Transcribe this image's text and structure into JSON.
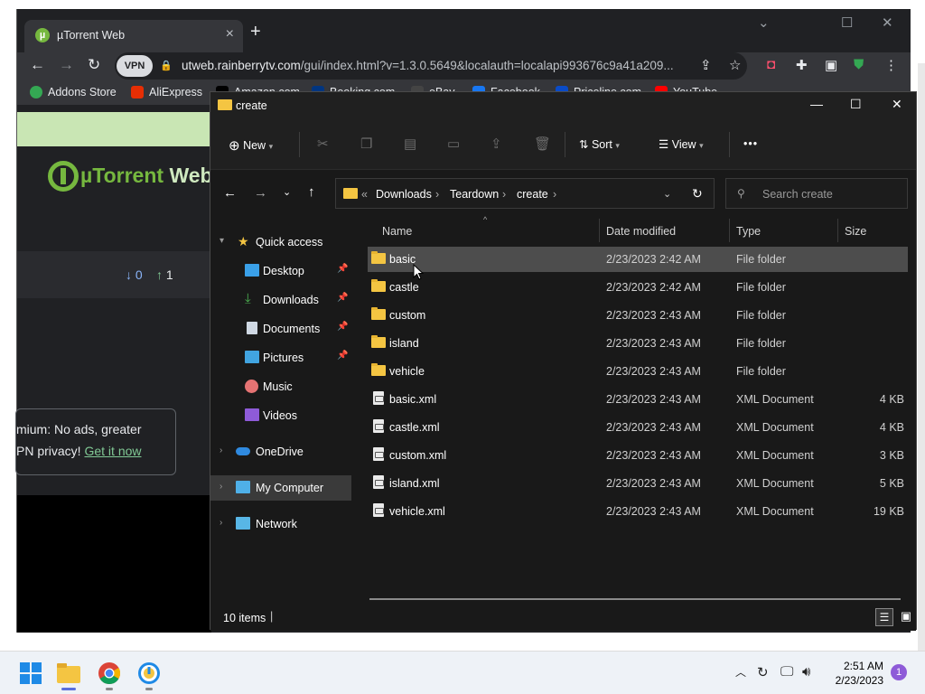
{
  "browser": {
    "tab_title": "µTorrent Web",
    "new_tab_icon": "plus-icon",
    "url_prefix": "utweb.rainberrytv.com",
    "url_rest": "/gui/index.html?v=1.3.0.5649&localauth=localapi993676c9a41a209...",
    "vpn_label": "VPN",
    "bookmarks": [
      "Addons Store",
      "AliExpress",
      "Amazon.com",
      "Booking.com",
      "eBay",
      "Facebook",
      "Priceline.com",
      "YouTube"
    ]
  },
  "utorrent_page": {
    "logo_mu": "µTorrent",
    "logo_web": "Web",
    "download_count": "0",
    "upload_count": "1",
    "promo_line1": "mium: No ads, greater",
    "promo_line2": "PN privacy!",
    "promo_link": "Get it now"
  },
  "explorer": {
    "window_title": "create",
    "commands": {
      "new": "New",
      "sort": "Sort",
      "view": "View",
      "more": "•••"
    },
    "breadcrumb": [
      "Downloads",
      "Teardown",
      "create"
    ],
    "search_placeholder": "Search create",
    "nav": {
      "quick_access": "Quick access",
      "desktop": "Desktop",
      "downloads": "Downloads",
      "documents": "Documents",
      "pictures": "Pictures",
      "music": "Music",
      "videos": "Videos",
      "onedrive": "OneDrive",
      "my_computer": "My Computer",
      "network": "Network"
    },
    "columns": {
      "name": "Name",
      "date": "Date modified",
      "type": "Type",
      "size": "Size"
    },
    "files": [
      {
        "name": "basic",
        "date": "2/23/2023 2:42 AM",
        "type": "File folder",
        "size": ""
      },
      {
        "name": "castle",
        "date": "2/23/2023 2:42 AM",
        "type": "File folder",
        "size": ""
      },
      {
        "name": "custom",
        "date": "2/23/2023 2:43 AM",
        "type": "File folder",
        "size": ""
      },
      {
        "name": "island",
        "date": "2/23/2023 2:43 AM",
        "type": "File folder",
        "size": ""
      },
      {
        "name": "vehicle",
        "date": "2/23/2023 2:43 AM",
        "type": "File folder",
        "size": ""
      },
      {
        "name": "basic.xml",
        "date": "2/23/2023 2:43 AM",
        "type": "XML Document",
        "size": "4 KB"
      },
      {
        "name": "castle.xml",
        "date": "2/23/2023 2:43 AM",
        "type": "XML Document",
        "size": "4 KB"
      },
      {
        "name": "custom.xml",
        "date": "2/23/2023 2:43 AM",
        "type": "XML Document",
        "size": "3 KB"
      },
      {
        "name": "island.xml",
        "date": "2/23/2023 2:43 AM",
        "type": "XML Document",
        "size": "5 KB"
      },
      {
        "name": "vehicle.xml",
        "date": "2/23/2023 2:43 AM",
        "type": "XML Document",
        "size": "19 KB"
      }
    ],
    "status": "10 items"
  },
  "taskbar": {
    "time": "2:51 AM",
    "date": "2/23/2023",
    "notification_count": "1"
  },
  "colors": {
    "utorrent_green": "#76b83f",
    "explorer_bg": "#191919",
    "folder_yellow": "#f4c542",
    "selection": "#4d4d4d"
  }
}
